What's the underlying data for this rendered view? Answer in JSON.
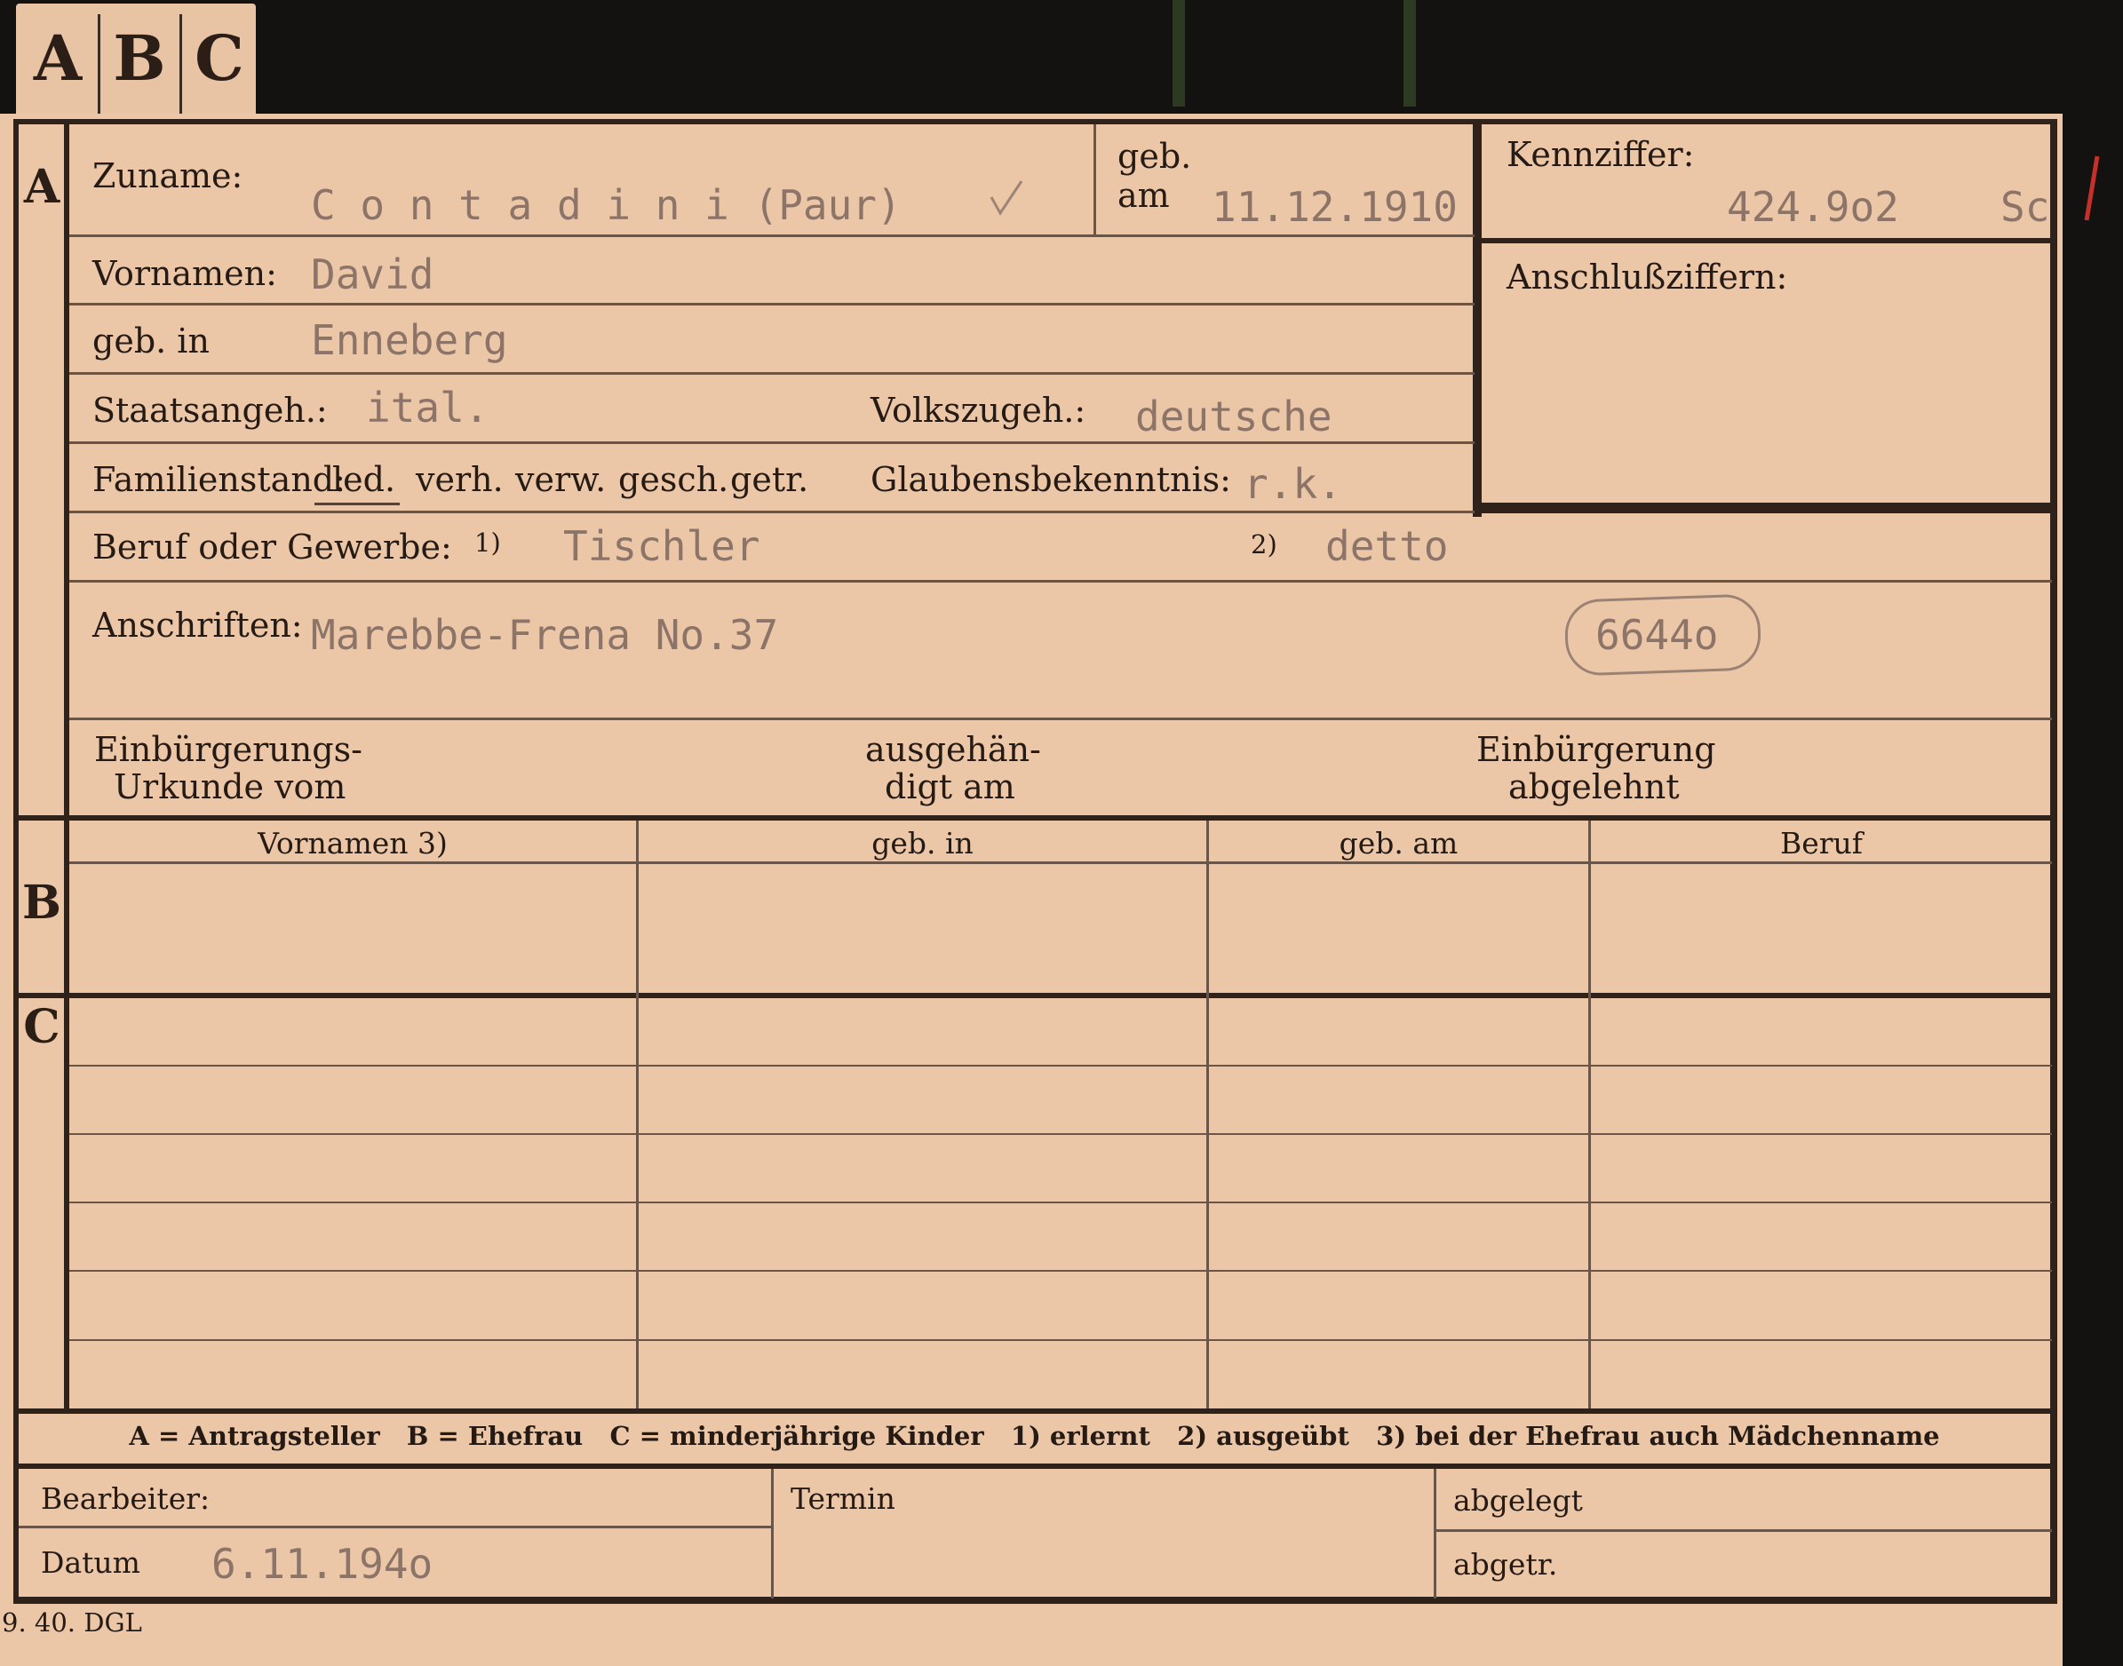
{
  "tab": {
    "letters": [
      "A",
      "B",
      "C"
    ]
  },
  "sections": {
    "a": "A",
    "b": "B",
    "c": "C"
  },
  "form": {
    "zuname_label": "Zuname:",
    "zuname_value": "C o n t a d i n i  (Paur)",
    "geb_label_1": "geb.",
    "geb_label_2": "am",
    "geb_am_value": "11.12.1910",
    "kennziffer_label": "Kennziffer:",
    "kennziffer_value": "424.9o2",
    "kennziffer_suffix": "Sch",
    "vornamen_label": "Vornamen:",
    "vornamen_value": "David",
    "anschluss_label": "Anschlußziffern:",
    "geb_in_label": "geb. in",
    "geb_in_value": "Enneberg",
    "staats_label": "Staatsangeh.:",
    "staats_value": "ital.",
    "volks_label": "Volkszugeh.:",
    "volks_value": "deutsche",
    "familien_label": "Familienstand:",
    "familien_options": [
      "led.",
      "verh.",
      "verw.",
      "gesch.",
      "getr."
    ],
    "familien_selected": "led.",
    "glaubens_label": "Glaubensbekenntnis:",
    "glaubens_value": "r.k.",
    "beruf_label": "Beruf oder Gewerbe:",
    "beruf_note_1": "1)",
    "beruf_value_1": "Tischler",
    "beruf_note_2": "2)",
    "beruf_value_2": "detto",
    "anschriften_label": "Anschriften:",
    "anschriften_value": "Marebbe-Frena No.37",
    "stamp_value": "6644o",
    "einb_urkunde_1": "Einbürgerungs-",
    "einb_urkunde_2": "Urkunde vom",
    "ausgehaendigt_1": "ausgehän-",
    "ausgehaendigt_2": "digt am",
    "einb_abgelehnt_1": "Einbürgerung",
    "einb_abgelehnt_2": "abgelehnt"
  },
  "table": {
    "headers": [
      "Vornamen 3)",
      "geb. in",
      "geb. am",
      "Beruf"
    ]
  },
  "footer": {
    "legend": "A = Antragsteller   B = Ehefrau   C = minderjährige Kinder   1) erlernt   2) ausgeübt   3) bei der Ehefrau auch Mädchenname",
    "bearbeiter_label": "Bearbeiter:",
    "termin_label": "Termin",
    "abgelegt_label": "abgelegt",
    "datum_label": "Datum",
    "datum_value": "6.11.194o",
    "abgetr_label": "abgetr.",
    "printer_mark": "9. 40. DGL"
  },
  "colors": {
    "card": "#ecc7a7",
    "ink": "#2a1e17",
    "typewriter": "#8c7568",
    "background": "#141210"
  }
}
